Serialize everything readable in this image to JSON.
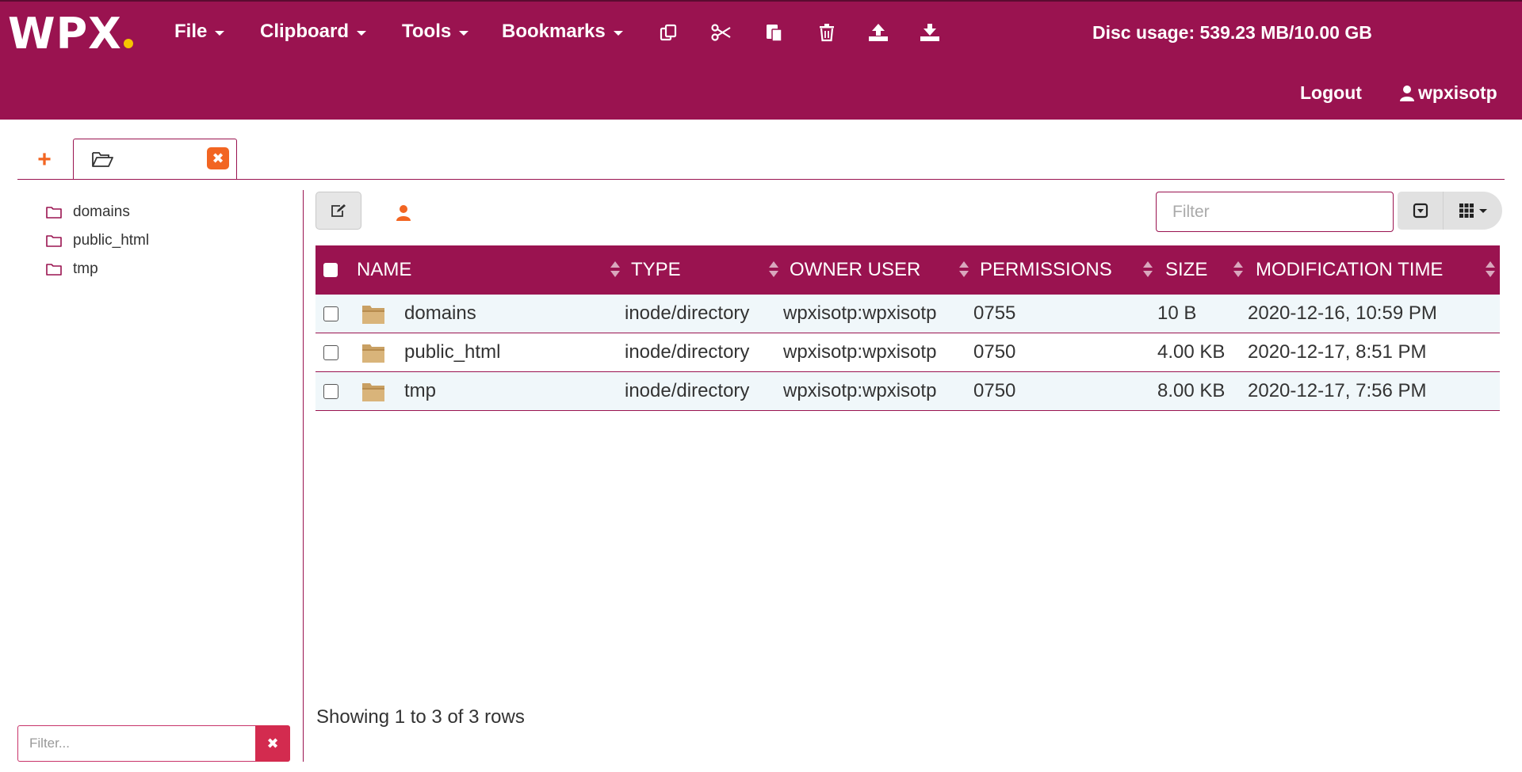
{
  "header": {
    "logo": "WPX",
    "menus": [
      "File",
      "Clipboard",
      "Tools",
      "Bookmarks"
    ],
    "toolbar_icons": [
      "copy-icon",
      "cut-icon",
      "paste-icon",
      "delete-icon",
      "upload-icon",
      "download-icon"
    ],
    "disc_usage": "Disc usage: 539.23 MB/10.00 GB",
    "logout": "Logout",
    "username": "wpxisotp"
  },
  "tabs": {
    "add_icon": "plus-icon",
    "active_tab_icon": "folder-open-icon",
    "close_icon": "close-icon"
  },
  "tree": {
    "items": [
      "domains",
      "public_html",
      "tmp"
    ],
    "filter_placeholder": "Filter..."
  },
  "toolbar": {
    "filter_placeholder": "Filter"
  },
  "table": {
    "columns": [
      "NAME",
      "TYPE",
      "OWNER USER",
      "PERMISSIONS",
      "SIZE",
      "MODIFICATION TIME"
    ],
    "rows": [
      {
        "name": "domains",
        "type": "inode/directory",
        "owner": "wpxisotp:wpxisotp",
        "permissions": "0755",
        "size": "10 B",
        "modified": "2020-12-16, 10:59 PM"
      },
      {
        "name": "public_html",
        "type": "inode/directory",
        "owner": "wpxisotp:wpxisotp",
        "permissions": "0750",
        "size": "4.00 KB",
        "modified": "2020-12-17, 8:51 PM"
      },
      {
        "name": "tmp",
        "type": "inode/directory",
        "owner": "wpxisotp:wpxisotp",
        "permissions": "0750",
        "size": "8.00 KB",
        "modified": "2020-12-17, 7:56 PM"
      }
    ],
    "footer": "Showing 1 to 3 of 3 rows"
  },
  "colors": {
    "brand": "#9a1350",
    "accent": "#f26522",
    "logo_dot": "#f5c400"
  }
}
